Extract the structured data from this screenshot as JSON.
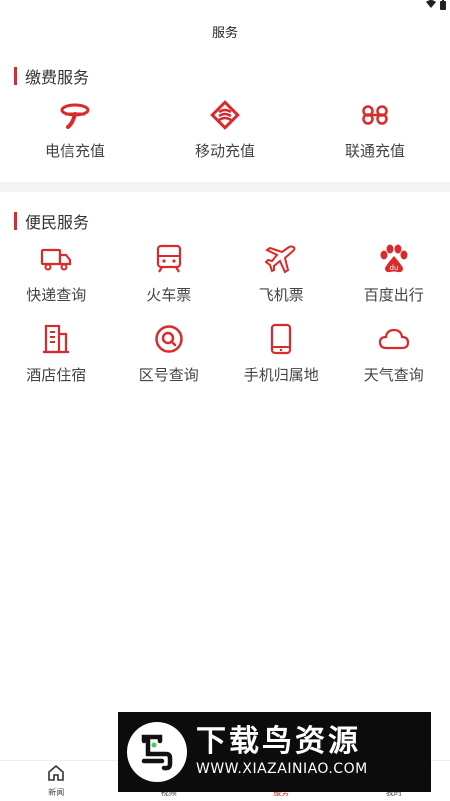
{
  "app": {
    "title": "服务"
  },
  "colors": {
    "accent": "#d92b2b",
    "text": "#333333",
    "divider": "#f4f4f4"
  },
  "sections": [
    {
      "title": "缴费服务",
      "items": [
        {
          "label": "电信充值",
          "icon": "telecom-logo-icon"
        },
        {
          "label": "移动充值",
          "icon": "china-mobile-logo-icon"
        },
        {
          "label": "联通充值",
          "icon": "unicom-logo-icon"
        }
      ]
    },
    {
      "title": "便民服务",
      "items": [
        {
          "label": "快递查询",
          "icon": "truck-icon"
        },
        {
          "label": "火车票",
          "icon": "train-icon"
        },
        {
          "label": "飞机票",
          "icon": "plane-icon"
        },
        {
          "label": "百度出行",
          "icon": "baidu-paw-icon"
        },
        {
          "label": "酒店住宿",
          "icon": "building-icon"
        },
        {
          "label": "区号查询",
          "icon": "search-icon"
        },
        {
          "label": "手机归属地",
          "icon": "phone-icon"
        },
        {
          "label": "天气查询",
          "icon": "cloud-icon"
        }
      ]
    }
  ],
  "tabbar": [
    {
      "label": "新闻",
      "icon": "home-icon",
      "active": false
    },
    {
      "label": "视频",
      "icon": "video-icon",
      "active": false
    },
    {
      "label": "服务",
      "icon": "service-icon",
      "active": true
    },
    {
      "label": "我的",
      "icon": "user-icon",
      "active": false
    }
  ],
  "watermark": {
    "title": "下载鸟资源",
    "url": "WWW.XIAZAINIAO.COM"
  }
}
